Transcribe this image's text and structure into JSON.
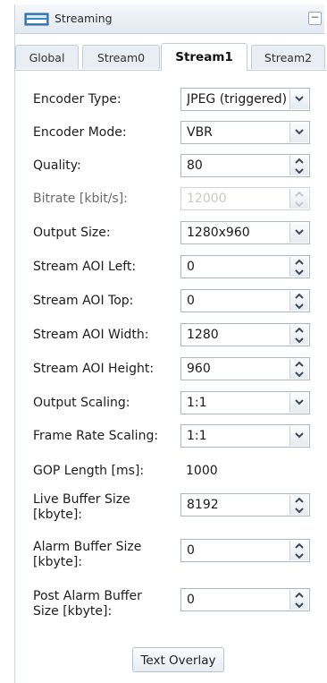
{
  "panel": {
    "title": "Streaming",
    "collapse_symbol": "−"
  },
  "tabs": [
    {
      "label": "Global"
    },
    {
      "label": "Stream0"
    },
    {
      "label": "Stream1"
    },
    {
      "label": "Stream2"
    }
  ],
  "fields": {
    "encoder_type": {
      "label": "Encoder Type:",
      "value": "JPEG (triggered)"
    },
    "encoder_mode": {
      "label": "Encoder Mode:",
      "value": "VBR"
    },
    "quality": {
      "label": "Quality:",
      "value": "80"
    },
    "bitrate": {
      "label": "Bitrate [kbit/s]:",
      "value": "12000"
    },
    "output_size": {
      "label": "Output Size:",
      "value": "1280x960"
    },
    "aoi_left": {
      "label": "Stream AOI Left:",
      "value": "0"
    },
    "aoi_top": {
      "label": "Stream AOI Top:",
      "value": "0"
    },
    "aoi_width": {
      "label": "Stream AOI Width:",
      "value": "1280"
    },
    "aoi_height": {
      "label": "Stream AOI Height:",
      "value": "960"
    },
    "output_scaling": {
      "label": "Output Scaling:",
      "value": "1:1"
    },
    "frame_rate_scaling": {
      "label": "Frame Rate Scaling:",
      "value": "1:1"
    },
    "gop_length": {
      "label": "GOP Length [ms]:",
      "value": "1000"
    },
    "live_buffer": {
      "label": "Live Buffer Size [kbyte]:",
      "value": "8192"
    },
    "alarm_buffer": {
      "label": "Alarm Buffer Size [kbyte]:",
      "value": "0"
    },
    "post_alarm_buffer": {
      "label": "Post Alarm Buffer Size [kbyte]:",
      "value": "0"
    }
  },
  "buttons": {
    "text_overlay": "Text Overlay"
  }
}
